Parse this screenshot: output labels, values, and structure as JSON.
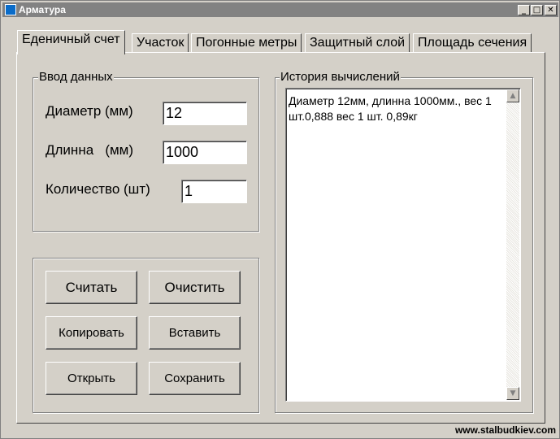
{
  "window": {
    "title": "Арматура",
    "buttons": {
      "minimize": "_",
      "maximize": "□",
      "close": "✕"
    }
  },
  "tabs": [
    {
      "label": "Еденичный счет",
      "active": true
    },
    {
      "label": "Участок",
      "active": false
    },
    {
      "label": "Погонные метры",
      "active": false
    },
    {
      "label": "Защитный слой",
      "active": false
    },
    {
      "label": "Площадь сечения",
      "active": false
    }
  ],
  "input_group": {
    "legend": "Ввод данных",
    "diameter": {
      "label": "Диаметр (мм)",
      "value": "12"
    },
    "length": {
      "label": "Длинна   (мм)",
      "value": "1000"
    },
    "quantity": {
      "label": "Количество (шт)",
      "value": "1"
    }
  },
  "actions": {
    "calculate": "Считать",
    "clear": "Очистить",
    "copy": "Копировать",
    "paste": "Вставить",
    "open": "Открыть",
    "save": "Сохранить"
  },
  "history": {
    "legend": "История вычислений",
    "text": "Диаметр 12мм, длинна 1000мм., вес 1 шт.0,888 вес 1 шт.  0,89кг",
    "scroll_up": "▲",
    "scroll_down": "▼"
  },
  "watermark": "www.stalbudkiev.com"
}
